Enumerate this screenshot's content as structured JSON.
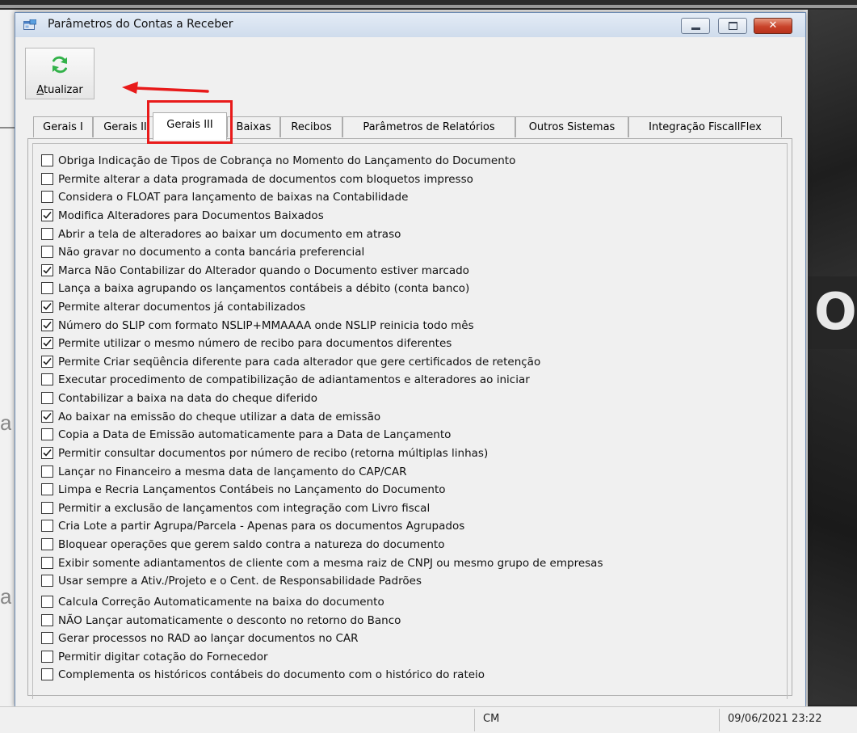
{
  "window": {
    "title": "Parâmetros do Contas a Receber",
    "min_glyph": "",
    "max_glyph": "",
    "close_glyph": "✕"
  },
  "toolbar": {
    "refresh_label_first": "A",
    "refresh_label_rest": "tualizar",
    "refresh_icon": "refresh-icon",
    "accent": "#33b24a"
  },
  "tabs": [
    {
      "label": "Gerais I"
    },
    {
      "label": "Gerais II"
    },
    {
      "label": "Gerais III"
    },
    {
      "label": "Baixas"
    },
    {
      "label": "Recibos"
    },
    {
      "label": "Parâmetros de Relatórios"
    },
    {
      "label": "Outros Sistemas"
    },
    {
      "label": "Integração FiscallFlex"
    }
  ],
  "active_tab": "Gerais III",
  "options": [
    {
      "label": "Obriga Indicação de Tipos de Cobrança no Momento do Lançamento do Documento",
      "checked": false
    },
    {
      "label": "Permite alterar a data programada de documentos com bloquetos impresso",
      "checked": false
    },
    {
      "label": "Considera o FLOAT para lançamento de baixas na Contabilidade",
      "checked": false
    },
    {
      "label": "Modifica Alteradores para Documentos Baixados",
      "checked": true
    },
    {
      "label": "Abrir a tela de alteradores ao baixar um documento em atraso",
      "checked": false
    },
    {
      "label": "Não gravar no documento a conta bancária preferencial",
      "checked": false
    },
    {
      "label": "Marca Não Contabilizar do Alterador quando o Documento estiver marcado",
      "checked": true
    },
    {
      "label": "Lança a baixa agrupando os lançamentos contábeis a débito (conta banco)",
      "checked": false
    },
    {
      "label": "Permite alterar documentos já contabilizados",
      "checked": true
    },
    {
      "label": "Número do SLIP com formato NSLIP+MMAAAA onde NSLIP reinicia todo mês",
      "checked": true
    },
    {
      "label": "Permite utilizar o mesmo número de recibo para documentos diferentes",
      "checked": true
    },
    {
      "label": "Permite Criar seqüência diferente para cada alterador que gere certificados de retenção",
      "checked": true
    },
    {
      "label": "Executar procedimento de compatibilização de adiantamentos e alteradores ao iniciar",
      "checked": false
    },
    {
      "label": "Contabilizar a baixa na data do cheque diferido",
      "checked": false
    },
    {
      "label": "Ao baixar na emissão do cheque utilizar a data de emissão",
      "checked": true
    },
    {
      "label": "Copia a Data de Emissão automaticamente para a Data de Lançamento",
      "checked": false
    },
    {
      "label": "Permitir consultar documentos por número de recibo (retorna múltiplas linhas)",
      "checked": true
    },
    {
      "label": "Lançar no Financeiro a mesma data de lançamento do CAP/CAR",
      "checked": false
    },
    {
      "label": "Limpa e Recria Lançamentos Contábeis no Lançamento do Documento",
      "checked": false
    },
    {
      "label": "Permitir a exclusão de lançamentos com integração com Livro fiscal",
      "checked": false
    },
    {
      "label": "Cria Lote a partir Agrupa/Parcela - Apenas para os documentos Agrupados",
      "checked": false
    },
    {
      "label": "Bloquear operações que gerem saldo contra a natureza do documento",
      "checked": false
    },
    {
      "label": "Exibir somente adiantamentos de cliente com a mesma raiz de CNPJ ou mesmo grupo de empresas",
      "checked": false
    },
    {
      "label": "Usar sempre a Ativ./Projeto e o Cent. de Responsabilidade Padrões",
      "checked": false
    },
    {
      "label": "Calcula Correção Automaticamente na baixa do documento",
      "checked": false
    },
    {
      "label": "NÃO Lançar automaticamente o desconto no retorno do Banco",
      "checked": false
    },
    {
      "label": "Gerar processos no RAD ao lançar documentos no CAR",
      "checked": false
    },
    {
      "label": "Permitir digitar cotação do Fornecedor",
      "checked": false
    },
    {
      "label": "Complementa os históricos contábeis do documento com o histórico do rateio",
      "checked": false
    }
  ],
  "statusbar": {
    "user": "CM",
    "datetime": "09/06/2021 23:22"
  },
  "background": {
    "left_fragment_1": "ac",
    "left_fragment_2": "ac",
    "right_fragment": "OT"
  },
  "colors": {
    "highlight": "#e81a1a",
    "check": "#1a1a1a",
    "close_button": "#c9432a"
  }
}
